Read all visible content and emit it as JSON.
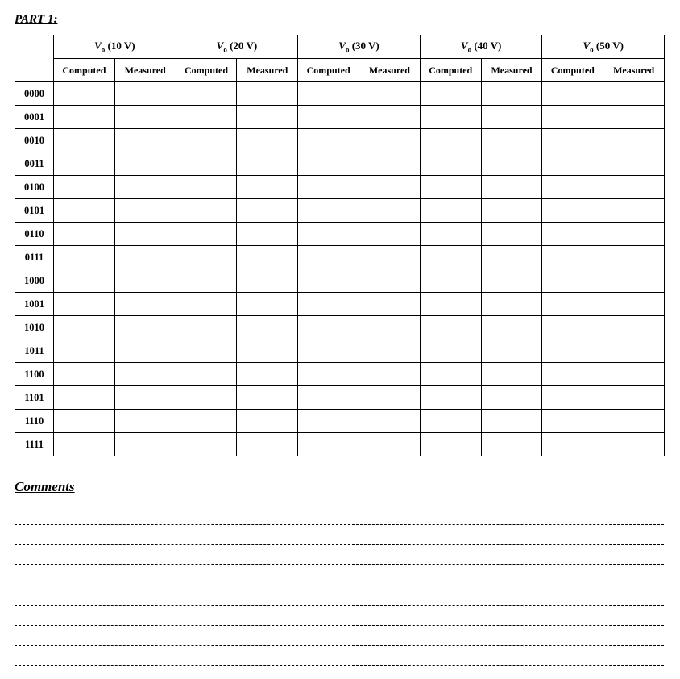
{
  "part1": {
    "title": "PART 1:",
    "voltage_groups": [
      {
        "symbol": "V",
        "sub": "o",
        "value": "10 V"
      },
      {
        "symbol": "V",
        "sub": "o",
        "value": "20 V"
      },
      {
        "symbol": "V",
        "sub": "o",
        "value": "30 V"
      },
      {
        "symbol": "V",
        "sub": "o",
        "value": "40 V"
      },
      {
        "symbol": "V",
        "sub": "o",
        "value": "50 V"
      }
    ],
    "sub_columns": [
      "Computed",
      "Measured"
    ],
    "rows": [
      {
        "code": "0000",
        "cells": [
          "",
          "",
          "",
          "",
          "",
          "",
          "",
          "",
          "",
          ""
        ]
      },
      {
        "code": "0001",
        "cells": [
          "",
          "",
          "",
          "",
          "",
          "",
          "",
          "",
          "",
          ""
        ]
      },
      {
        "code": "0010",
        "cells": [
          "",
          "",
          "",
          "",
          "",
          "",
          "",
          "",
          "",
          ""
        ]
      },
      {
        "code": "0011",
        "cells": [
          "",
          "",
          "",
          "",
          "",
          "",
          "",
          "",
          "",
          ""
        ]
      },
      {
        "code": "0100",
        "cells": [
          "",
          "",
          "",
          "",
          "",
          "",
          "",
          "",
          "",
          ""
        ]
      },
      {
        "code": "0101",
        "cells": [
          "",
          "",
          "",
          "",
          "",
          "",
          "",
          "",
          "",
          ""
        ]
      },
      {
        "code": "0110",
        "cells": [
          "",
          "",
          "",
          "",
          "",
          "",
          "",
          "",
          "",
          ""
        ]
      },
      {
        "code": "0111",
        "cells": [
          "",
          "",
          "",
          "",
          "",
          "",
          "",
          "",
          "",
          ""
        ]
      },
      {
        "code": "1000",
        "cells": [
          "",
          "",
          "",
          "",
          "",
          "",
          "",
          "",
          "",
          ""
        ]
      },
      {
        "code": "1001",
        "cells": [
          "",
          "",
          "",
          "",
          "",
          "",
          "",
          "",
          "",
          ""
        ]
      },
      {
        "code": "1010",
        "cells": [
          "",
          "",
          "",
          "",
          "",
          "",
          "",
          "",
          "",
          ""
        ]
      },
      {
        "code": "1011",
        "cells": [
          "",
          "",
          "",
          "",
          "",
          "",
          "",
          "",
          "",
          ""
        ]
      },
      {
        "code": "1100",
        "cells": [
          "",
          "",
          "",
          "",
          "",
          "",
          "",
          "",
          "",
          ""
        ]
      },
      {
        "code": "1101",
        "cells": [
          "",
          "",
          "",
          "",
          "",
          "",
          "",
          "",
          "",
          ""
        ]
      },
      {
        "code": "1110",
        "cells": [
          "",
          "",
          "",
          "",
          "",
          "",
          "",
          "",
          "",
          ""
        ]
      },
      {
        "code": "1111",
        "cells": [
          "",
          "",
          "",
          "",
          "",
          "",
          "",
          "",
          "",
          ""
        ]
      }
    ]
  },
  "comments": {
    "title": "Comments",
    "line_count": 8
  }
}
